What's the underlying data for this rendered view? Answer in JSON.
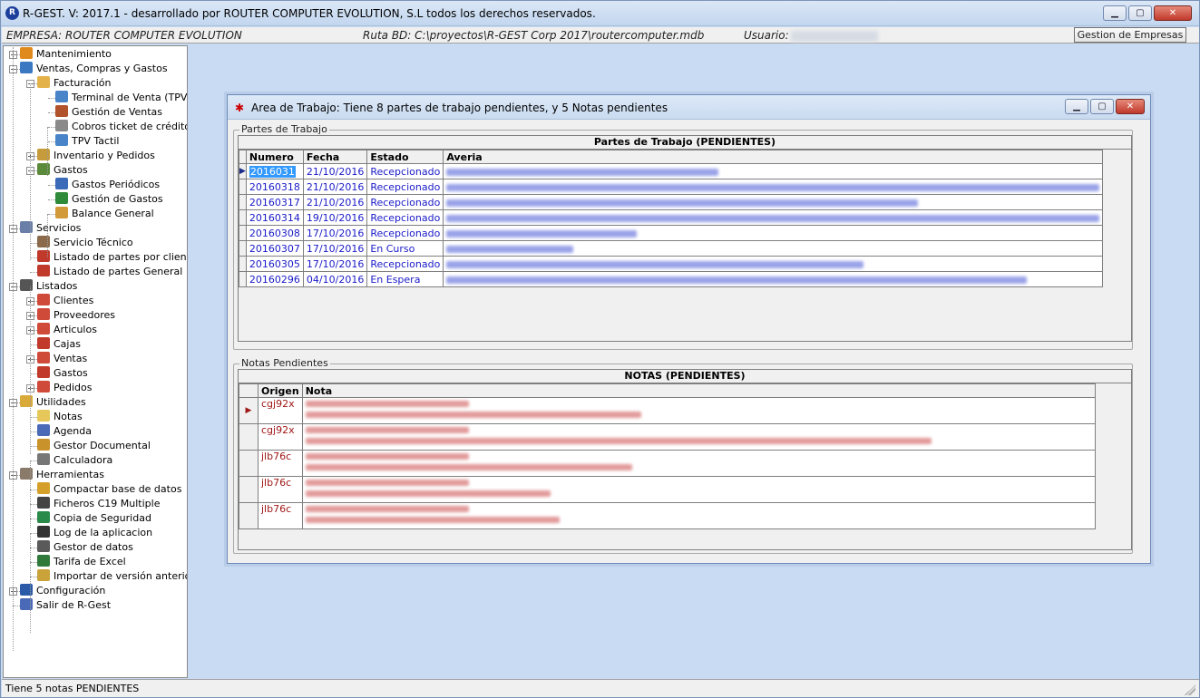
{
  "window": {
    "title": "R-GEST. V: 2017.1 - desarrollado por ROUTER COMPUTER EVOLUTION, S.L todos los derechos reservados.",
    "min_label": "▁",
    "max_label": "▢",
    "close_label": "✕"
  },
  "infobar": {
    "empresa": "EMPRESA: ROUTER COMPUTER EVOLUTION",
    "ruta": "Ruta BD: C:\\proyectos\\R-GEST Corp 2017\\routercomputer.mdb",
    "usuario_label": "Usuario:",
    "gestion_button": "Gestion de Empresas"
  },
  "tree": [
    {
      "label": "Mantenimiento",
      "icon": "house-icon",
      "color": "#e08a1e",
      "level": 0,
      "exp": "+"
    },
    {
      "label": "Ventas, Compras y Gastos",
      "icon": "book-icon",
      "color": "#3a78c2",
      "level": 0,
      "exp": "-"
    },
    {
      "label": "Facturación",
      "icon": "folder-icon",
      "color": "#e3b34a",
      "level": 1,
      "exp": "-"
    },
    {
      "label": "Terminal de Venta (TPV)",
      "icon": "monitor-icon",
      "color": "#4a84c8",
      "level": 2,
      "exp": ""
    },
    {
      "label": "Gestión de Ventas",
      "icon": "user-icon",
      "color": "#b0522a",
      "level": 2,
      "exp": ""
    },
    {
      "label": "Cobros ticket de crédito",
      "icon": "ticket-icon",
      "color": "#8a8a8a",
      "level": 2,
      "exp": ""
    },
    {
      "label": "TPV Tactil",
      "icon": "touch-screen-icon",
      "color": "#4a84c8",
      "level": 2,
      "exp": ""
    },
    {
      "label": "Inventario y Pedidos",
      "icon": "boxes-icon",
      "color": "#c69b3b",
      "level": 1,
      "exp": "+"
    },
    {
      "label": "Gastos",
      "icon": "ledger-icon",
      "color": "#5a8a3a",
      "level": 1,
      "exp": "-"
    },
    {
      "label": "Gastos Periódicos",
      "icon": "calendar-edit-icon",
      "color": "#3a6ab8",
      "level": 2,
      "exp": ""
    },
    {
      "label": "Gestión de Gastos",
      "icon": "money-icon",
      "color": "#2f8a3a",
      "level": 2,
      "exp": ""
    },
    {
      "label": "Balance General",
      "icon": "scale-icon",
      "color": "#d39a3a",
      "level": 2,
      "exp": ""
    },
    {
      "label": "Servicios",
      "icon": "services-icon",
      "color": "#6a7fa8",
      "level": 0,
      "exp": "-"
    },
    {
      "label": "Servicio Técnico",
      "icon": "tools-icon",
      "color": "#8a6a4a",
      "level": 1,
      "exp": ""
    },
    {
      "label": "Listado de partes por cliente",
      "icon": "pdf-report-icon",
      "color": "#c0392b",
      "level": 1,
      "exp": ""
    },
    {
      "label": "Listado de partes General",
      "icon": "pdf-report-icon",
      "color": "#c0392b",
      "level": 1,
      "exp": ""
    },
    {
      "label": "Listados",
      "icon": "list-icon",
      "color": "#555555",
      "level": 0,
      "exp": "-"
    },
    {
      "label": "Clientes",
      "icon": "chart-report-icon",
      "color": "#d04a3a",
      "level": 1,
      "exp": "+"
    },
    {
      "label": "Proveedores",
      "icon": "chart-report-icon",
      "color": "#d04a3a",
      "level": 1,
      "exp": "+"
    },
    {
      "label": "Articulos",
      "icon": "chart-report-icon",
      "color": "#d04a3a",
      "level": 1,
      "exp": "+"
    },
    {
      "label": "Cajas",
      "icon": "pdf-report-icon",
      "color": "#c0392b",
      "level": 1,
      "exp": ""
    },
    {
      "label": "Ventas",
      "icon": "chart-report-icon",
      "color": "#d04a3a",
      "level": 1,
      "exp": "+"
    },
    {
      "label": "Gastos",
      "icon": "pdf-report-icon",
      "color": "#c0392b",
      "level": 1,
      "exp": ""
    },
    {
      "label": "Pedidos",
      "icon": "chart-report-icon",
      "color": "#d04a3a",
      "level": 1,
      "exp": "+"
    },
    {
      "label": "Utilidades",
      "icon": "utilities-icon",
      "color": "#d9a93a",
      "level": 0,
      "exp": "-"
    },
    {
      "label": "Notas",
      "icon": "notes-icon",
      "color": "#e6c85a",
      "level": 1,
      "exp": ""
    },
    {
      "label": "Agenda",
      "icon": "clock-icon",
      "color": "#4a6ab8",
      "level": 1,
      "exp": ""
    },
    {
      "label": "Gestor Documental",
      "icon": "document-manager-icon",
      "color": "#c9922a",
      "level": 1,
      "exp": ""
    },
    {
      "label": "Calculadora",
      "icon": "calculator-icon",
      "color": "#777777",
      "level": 1,
      "exp": ""
    },
    {
      "label": "Herramientas",
      "icon": "hammer-icon",
      "color": "#8a7a6a",
      "level": 0,
      "exp": "-"
    },
    {
      "label": "Compactar base de datos",
      "icon": "compress-db-icon",
      "color": "#d4a02a",
      "level": 1,
      "exp": ""
    },
    {
      "label": "Ficheros C19 Multiple",
      "icon": "file-list-icon",
      "color": "#444444",
      "level": 1,
      "exp": ""
    },
    {
      "label": "Copia de Seguridad",
      "icon": "backup-globe-icon",
      "color": "#2a8a4a",
      "level": 1,
      "exp": ""
    },
    {
      "label": "Log de la aplicacion",
      "icon": "log-icon",
      "color": "#333333",
      "level": 1,
      "exp": ""
    },
    {
      "label": "Gestor de datos",
      "icon": "data-grid-icon",
      "color": "#5a5a5a",
      "level": 1,
      "exp": ""
    },
    {
      "label": "Tarifa de Excel",
      "icon": "excel-icon",
      "color": "#2f7a3a",
      "level": 1,
      "exp": ""
    },
    {
      "label": "Importar de versión anterior",
      "icon": "import-icon",
      "color": "#c9a23a",
      "level": 1,
      "exp": ""
    },
    {
      "label": "Configuración",
      "icon": "settings-icon",
      "color": "#2a5aa8",
      "level": 0,
      "exp": "+"
    },
    {
      "label": "Salir de R-Gest",
      "icon": "exit-door-icon",
      "color": "#4a6ab8",
      "level": 0,
      "exp": ""
    }
  ],
  "work_window": {
    "title": "Area de Trabajo: Tiene 8 partes de trabajo pendientes, y 5 Notas pendientes",
    "partes_group": "Partes de Trabajo",
    "partes_caption": "Partes de Trabajo (PENDIENTES)",
    "partes_columns": [
      "Numero",
      "Fecha",
      "Estado",
      "Averia"
    ],
    "partes_rows": [
      {
        "numero": "2016031",
        "fecha": "21/10/2016",
        "estado": "Recepcionado",
        "blur_w": 300
      },
      {
        "numero": "20160318",
        "fecha": "21/10/2016",
        "estado": "Recepcionado",
        "blur_w": 720
      },
      {
        "numero": "20160317",
        "fecha": "21/10/2016",
        "estado": "Recepcionado",
        "blur_w": 520
      },
      {
        "numero": "20160314",
        "fecha": "19/10/2016",
        "estado": "Recepcionado",
        "blur_w": 720
      },
      {
        "numero": "20160308",
        "fecha": "17/10/2016",
        "estado": "Recepcionado",
        "blur_w": 210
      },
      {
        "numero": "20160307",
        "fecha": "17/10/2016",
        "estado": "En Curso",
        "blur_w": 140
      },
      {
        "numero": "20160305",
        "fecha": "17/10/2016",
        "estado": "Recepcionado",
        "blur_w": 460
      },
      {
        "numero": "20160296",
        "fecha": "04/10/2016",
        "estado": "En Espera",
        "blur_w": 640
      }
    ],
    "notas_group": "Notas Pendientes",
    "notas_caption": "NOTAS (PENDIENTES)",
    "notas_columns": [
      "Origen",
      "Nota"
    ],
    "notas_rows": [
      {
        "origen": "cgj92x",
        "blur_w1": 180,
        "blur_w2": 370
      },
      {
        "origen": "cgj92x",
        "blur_w1": 180,
        "blur_w2": 690
      },
      {
        "origen": "jlb76c",
        "blur_w1": 180,
        "blur_w2": 360
      },
      {
        "origen": "jlb76c",
        "blur_w1": 180,
        "blur_w2": 270
      },
      {
        "origen": "jlb76c",
        "blur_w1": 180,
        "blur_w2": 280
      }
    ]
  },
  "status": {
    "text": "Tiene 5 notas PENDIENTES"
  },
  "colors": {
    "desktop": "#c9dbf2",
    "grid_text": "#1a1ac8",
    "notes_text": "#a01818",
    "selection": "#3399ff"
  }
}
